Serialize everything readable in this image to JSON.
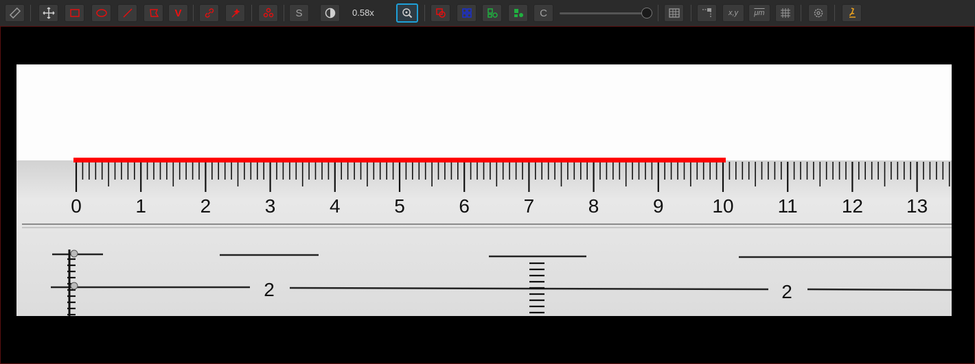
{
  "toolbar": {
    "zoom_label": "0.58x",
    "tools": [
      {
        "name": "ruler-icon",
        "color": "#9a9a9a"
      },
      {
        "name": "move-icon",
        "color": "#cfcfcf"
      },
      {
        "name": "rectangle-icon",
        "color": "#e01010"
      },
      {
        "name": "ellipse-icon",
        "color": "#e01010"
      },
      {
        "name": "line-icon",
        "color": "#e01010"
      },
      {
        "name": "polygon-icon",
        "color": "#e01010"
      },
      {
        "name": "angle-icon",
        "color": "#e01010"
      },
      {
        "name": "link-icon",
        "color": "#e01010"
      },
      {
        "name": "magic-wand-icon",
        "color": "#e01010"
      },
      {
        "name": "clusters-icon",
        "color": "#e01010"
      },
      {
        "name": "scale-icon",
        "color": "#a0a0a0"
      },
      {
        "name": "contrast-icon",
        "color": "#cfcfcf"
      },
      {
        "name": "zoom-icon",
        "color": "#cfcfcf"
      },
      {
        "name": "overlap-icon",
        "color": "#e01010"
      },
      {
        "name": "grid-select-icon",
        "color": "#1a2fd0"
      },
      {
        "name": "shapes-green-icon",
        "color": "#20b040"
      },
      {
        "name": "shapes-green-filled-icon",
        "color": "#20b040"
      },
      {
        "name": "clear-icon",
        "color": "#a0a0a0"
      },
      {
        "name": "table-icon",
        "color": "#9a9a9a"
      },
      {
        "name": "crop-icon",
        "color": "#9a9a9a"
      },
      {
        "name": "coordinates-icon",
        "color": "#9a9a9a"
      },
      {
        "name": "micrometer-icon",
        "color": "#9a9a9a"
      },
      {
        "name": "grid-overlay-icon",
        "color": "#9a9a9a"
      },
      {
        "name": "settings-icon",
        "color": "#9a9a9a"
      },
      {
        "name": "microscope-icon",
        "color": "#e8a020"
      }
    ],
    "letters": {
      "scale": "S",
      "angle": "V",
      "clear": "C",
      "coords": "x,y",
      "micrometer": "μm"
    }
  },
  "ruler": {
    "scale_numbers": [
      "0",
      "1",
      "2",
      "3",
      "4",
      "5",
      "6",
      "7",
      "8",
      "9",
      "10",
      "11",
      "12",
      "13"
    ],
    "lower_numbers": [
      "2",
      "2"
    ]
  },
  "colors": {
    "measurement": "#ff0000",
    "accent": "#1ea0d8",
    "frame": "#5a1010"
  }
}
